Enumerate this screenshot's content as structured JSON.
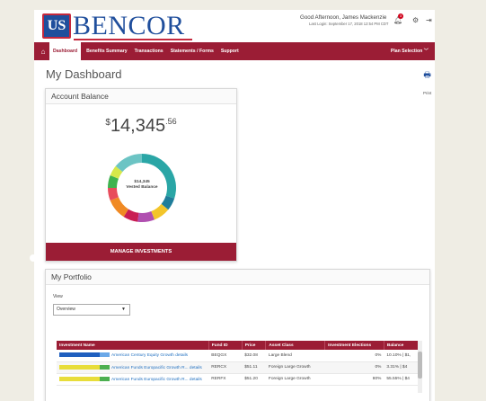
{
  "brand": {
    "logo_mark": "US",
    "logo_text": "BENCOR",
    "primary": "#1f4e9c",
    "accent": "#9b1d35"
  },
  "header": {
    "greeting": "Good Afternoon, James Mackenzie",
    "last_login": "Last Login: September 17, 2018 12:54 PM CDT",
    "notification_count": "3",
    "icons": [
      "bell-icon",
      "gear-icon",
      "sign-out-icon"
    ]
  },
  "nav": {
    "items": [
      {
        "label": "Dashboard",
        "active": true
      },
      {
        "label": "Benefits Summary"
      },
      {
        "label": "Transactions"
      },
      {
        "label": "Statements / Forms"
      },
      {
        "label": "Support"
      }
    ],
    "plan_selection": "Plan Selection"
  },
  "page": {
    "title": "My Dashboard",
    "print_label": "Print"
  },
  "account_balance": {
    "title": "Account Balance",
    "currency": "$",
    "amount": "14,345",
    "cents": ".56",
    "donut_amount": "$14,345",
    "donut_label": "Vested Balance",
    "button": "MANAGE INVESTMENTS",
    "segments": [
      {
        "color": "#2aa6a6",
        "value": 30
      },
      {
        "color": "#1f7d9a",
        "value": 6
      },
      {
        "color": "#f3c52a",
        "value": 8
      },
      {
        "color": "#b04fb0",
        "value": 8
      },
      {
        "color": "#c91d54",
        "value": 7
      },
      {
        "color": "#f08a24",
        "value": 10
      },
      {
        "color": "#e84c5c",
        "value": 6
      },
      {
        "color": "#3fb34f",
        "value": 6
      },
      {
        "color": "#d6e84a",
        "value": 5
      },
      {
        "color": "#6cc4c4",
        "value": 14
      }
    ]
  },
  "portfolio": {
    "title": "My Portfolio",
    "view_label": "View",
    "view_value": "Overview",
    "columns": [
      "Investment Name",
      "Fund ID",
      "Price",
      "Asset Class",
      "Investment Elections",
      "Balance"
    ],
    "rows": [
      {
        "name": "American Century Equity Growth",
        "detail": "details",
        "fund_id": "BEQGX",
        "price": "$32.08",
        "asset_class": "Large Blend",
        "elections": "0%",
        "balance": "10.10% | $1,",
        "bar": [
          "#1f5fbf",
          "#6aa8e8"
        ]
      },
      {
        "name": "American Funds Europacific Growth R...",
        "detail": "details",
        "fund_id": "RERCX",
        "price": "$51.11",
        "asset_class": "Foreign Large Growth",
        "elections": "0%",
        "balance": "3.31% | $4",
        "bar": [
          "#e8dd3a",
          "#4caf50"
        ]
      },
      {
        "name": "American Funds Europacific Growth R...",
        "detail": "details",
        "fund_id": "RERFX",
        "price": "$51.20",
        "asset_class": "Foreign Large Growth",
        "elections": "80%",
        "balance": "55.55% | $4",
        "bar": [
          "#e8dd3a",
          "#4caf50"
        ]
      }
    ]
  }
}
